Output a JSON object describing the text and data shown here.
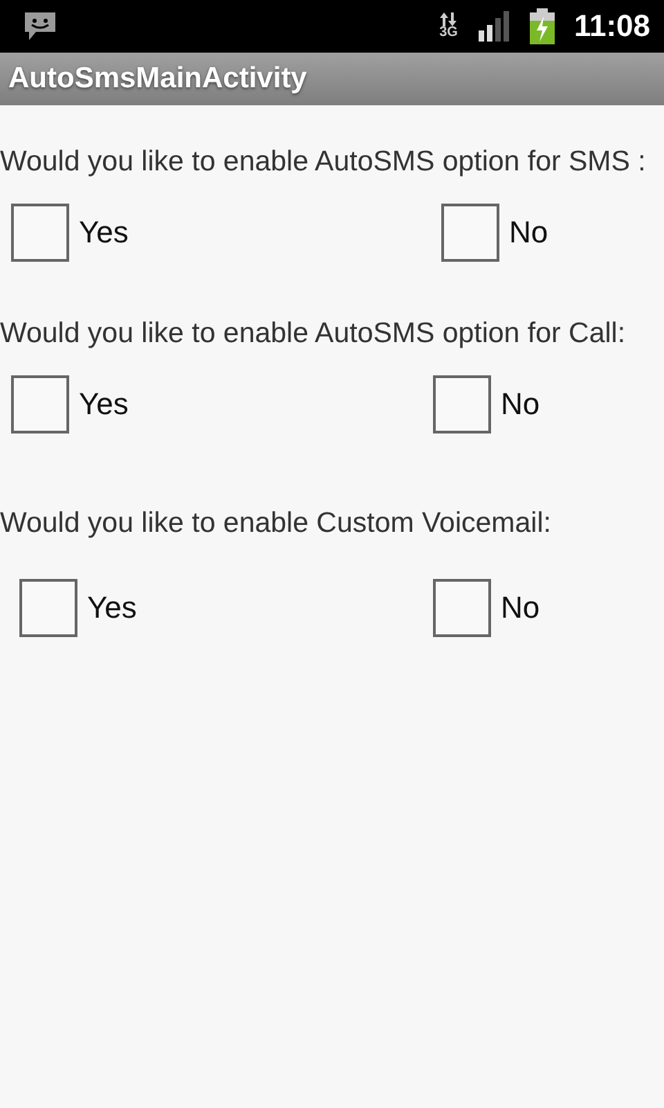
{
  "status_bar": {
    "network": "3G",
    "time": "11:08"
  },
  "title_bar": {
    "title": "AutoSmsMainActivity"
  },
  "questions": [
    {
      "text": "Would you like to enable AutoSMS option for SMS :",
      "options": [
        {
          "label": "Yes",
          "checked": false
        },
        {
          "label": "No",
          "checked": false
        }
      ]
    },
    {
      "text": "Would you like to enable AutoSMS option for Call:",
      "options": [
        {
          "label": "Yes",
          "checked": false
        },
        {
          "label": "No",
          "checked": false
        }
      ]
    },
    {
      "text": "Would you like to enable Custom Voicemail:",
      "options": [
        {
          "label": "Yes",
          "checked": false
        },
        {
          "label": "No",
          "checked": false
        }
      ]
    }
  ]
}
